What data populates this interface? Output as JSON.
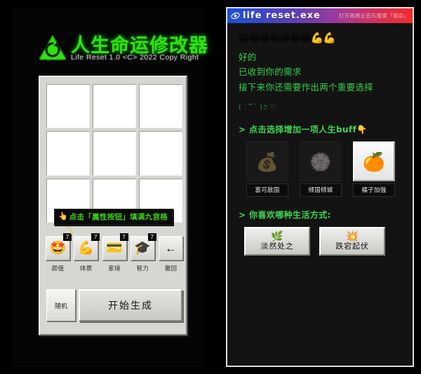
{
  "left": {
    "app_title": "人生命运修改器",
    "app_subtitle": "Life Reset  1.0  <C>  2022 Copy Right",
    "logo_icon": "green-triangle-refresh-logo",
    "grid": {
      "cells": [
        "",
        "",
        "",
        "",
        "",
        "",
        "",
        "",
        ""
      ]
    },
    "tooltip": {
      "hand_icon": "👆",
      "text": "点击「属性按钮」填满九宫格"
    },
    "attributes": [
      {
        "label": "颜值",
        "badge": "7",
        "icon": "🤩"
      },
      {
        "label": "体质",
        "badge": "7",
        "icon": "💪"
      },
      {
        "label": "家境",
        "badge": "7",
        "icon": "💳"
      },
      {
        "label": "智力",
        "badge": "7",
        "icon": "🎓"
      },
      {
        "label": "撤回",
        "badge": "",
        "icon": "←"
      }
    ],
    "random_label": "随机",
    "start_label": "开始生成"
  },
  "right": {
    "titlebar": {
      "icon": "life-reset-app-icon",
      "title": "life reset.exe",
      "note": "打开网易云音乐搜索「宿命」"
    },
    "emoji_row": "😁😁😁😁😁😁😁💪💪",
    "messages": [
      "好的",
      "已收到你的需求",
      "接下来你还需要作出两个重要选择"
    ],
    "kaomoji": "( ˙꒳˙ )੭ ♡",
    "buff_section": {
      "heading": "> 点击选择增加一项人生buff👇",
      "options": [
        {
          "label": "富可敌国",
          "icon": "💰",
          "state": "dim"
        },
        {
          "label": "倾国倾城",
          "icon": "💮",
          "state": "dim"
        },
        {
          "label": "橘子加强",
          "icon": "🍊",
          "state": "active"
        }
      ]
    },
    "life_section": {
      "heading": "> 你喜欢哪种生活方式:",
      "options": [
        {
          "label": "淡然处之",
          "icon": "🌿"
        },
        {
          "label": "跌宕起伏",
          "icon": "💥"
        }
      ]
    }
  },
  "colors": {
    "accent_green": "#2fe310",
    "msg_green": "#31d04a",
    "background": "#000000",
    "panel_gray": "#d6d6d2"
  }
}
